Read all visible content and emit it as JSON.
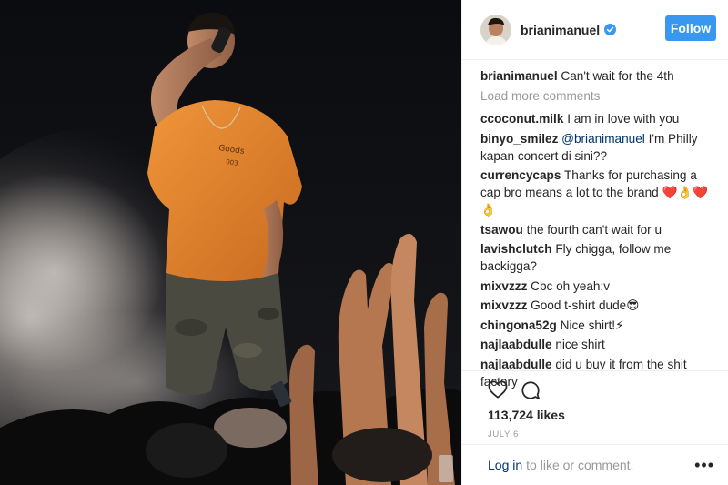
{
  "header": {
    "username": "brianimanuel",
    "follow_label": "Follow"
  },
  "caption": {
    "user": "brianimanuel",
    "text": "Can't wait for the 4th"
  },
  "load_more_label": "Load more comments",
  "comments": [
    {
      "user": "ccoconut.milk",
      "mention": "",
      "text": "I am in love with you"
    },
    {
      "user": "binyo_smilez",
      "mention": "@brianimanuel",
      "text": "I'm Philly kapan concert di sini??"
    },
    {
      "user": "currencycaps",
      "mention": "",
      "text": "Thanks for purchasing a cap bro means a lot to the brand ❤️👌❤️👌"
    },
    {
      "user": "tsawou",
      "mention": "",
      "text": "the fourth can't wait for u"
    },
    {
      "user": "lavishclutch",
      "mention": "",
      "text": "Fly chigga, follow me backigga?"
    },
    {
      "user": "mixvzzz",
      "mention": "",
      "text": "Cbc oh yeah:v"
    },
    {
      "user": "mixvzzz",
      "mention": "",
      "text": "Good t-shirt dude😎"
    },
    {
      "user": "chingona52g",
      "mention": "",
      "text": "Nice shirt!⚡"
    },
    {
      "user": "najlaabdulle",
      "mention": "",
      "text": "nice shirt"
    },
    {
      "user": "najlaabdulle",
      "mention": "",
      "text": "did u buy it from the shit factory"
    }
  ],
  "likes": "113,724 likes",
  "date": "JULY 6",
  "footer": {
    "login_label": "Log in",
    "rest_text": "to like or comment.",
    "more_label": "•••"
  },
  "icons": {
    "like": "heart-icon",
    "comment": "comment-bubble-icon",
    "verified": "verified-badge-icon",
    "more": "more-options-icon"
  },
  "colors": {
    "accent": "#3897f0",
    "link": "#003569",
    "muted": "#999999",
    "shirt": "#e0852e"
  }
}
